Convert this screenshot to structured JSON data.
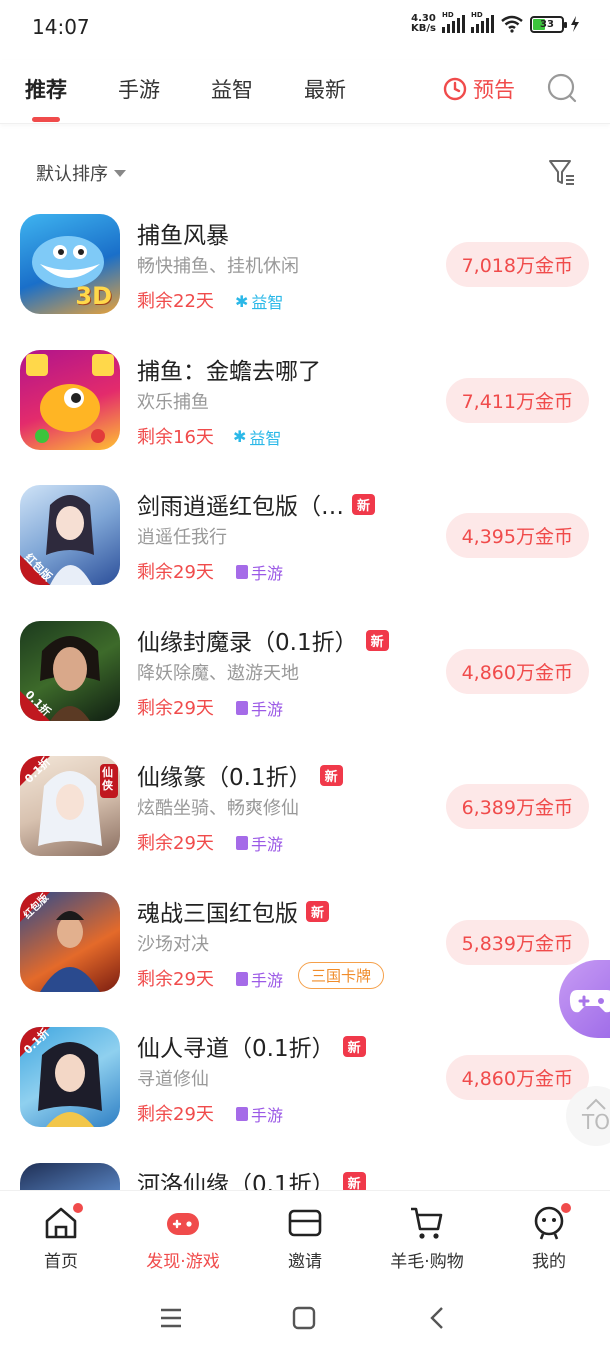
{
  "status_bar": {
    "time": "14:07",
    "net_speed": "4.30",
    "net_unit": "KB/s",
    "battery": "33"
  },
  "tabs": [
    {
      "label": "推荐",
      "active": true
    },
    {
      "label": "手游"
    },
    {
      "label": "益智"
    },
    {
      "label": "最新"
    }
  ],
  "preview_label": "预告",
  "sort_label": "默认排序",
  "games": [
    {
      "title": "捕鱼风暴",
      "subtitle": "畅快捕鱼、挂机休闲",
      "remain": "剩余22天",
      "category": "益智",
      "coins": "7,018万金币",
      "is_new": false
    },
    {
      "title": "捕鱼：金蟾去哪了",
      "subtitle": "欢乐捕鱼",
      "remain": "剩余16天",
      "category": "益智",
      "coins": "7,411万金币",
      "is_new": false
    },
    {
      "title": "剑雨逍遥红包版（…",
      "subtitle": "逍遥任我行",
      "remain": "剩余29天",
      "category": "手游",
      "coins": "4,395万金币",
      "is_new": true
    },
    {
      "title": "仙缘封魔录（0.1折）",
      "subtitle": "降妖除魔、遨游天地",
      "remain": "剩余29天",
      "category": "手游",
      "coins": "4,860万金币",
      "is_new": true
    },
    {
      "title": "仙缘篆（0.1折）",
      "subtitle": "炫酷坐骑、畅爽修仙",
      "remain": "剩余29天",
      "category": "手游",
      "coins": "6,389万金币",
      "is_new": true
    },
    {
      "title": "魂战三国红包版",
      "subtitle": "沙场对决",
      "remain": "剩余29天",
      "category": "手游",
      "extra_tag": "三国卡牌",
      "coins": "5,839万金币",
      "is_new": true
    },
    {
      "title": "仙人寻道（0.1折）",
      "subtitle": "寻道修仙",
      "remain": "剩余29天",
      "category": "手游",
      "coins": "4,860万金币",
      "is_new": true
    },
    {
      "title": "河洛仙缘（0.1折）",
      "subtitle": "",
      "remain": "",
      "category": "",
      "coins": "",
      "is_new": true
    }
  ],
  "new_tag": "新",
  "thumb_texts": {
    "g0": "3D",
    "g2": "红包版",
    "g3": "0.1折",
    "g4": "0.1折",
    "g4b": "仙侠",
    "g5": "红包版",
    "g6": "0.1折"
  },
  "top_button": "TO",
  "bottom_nav": [
    {
      "label": "首页",
      "icon": "home-icon",
      "dot": true
    },
    {
      "label": "发现·游戏",
      "icon": "gamepad-icon",
      "active": true
    },
    {
      "label": "邀请",
      "icon": "envelope-icon"
    },
    {
      "label": "羊毛·购物",
      "icon": "cart-icon"
    },
    {
      "label": "我的",
      "icon": "profile-icon",
      "dot": true
    }
  ],
  "colors": {
    "accent": "#f04b4b",
    "coin_bg": "#fde8e8",
    "puzzle": "#2bb8e8",
    "mobile": "#9b59e6",
    "extra_tag": "#f08c2a"
  }
}
